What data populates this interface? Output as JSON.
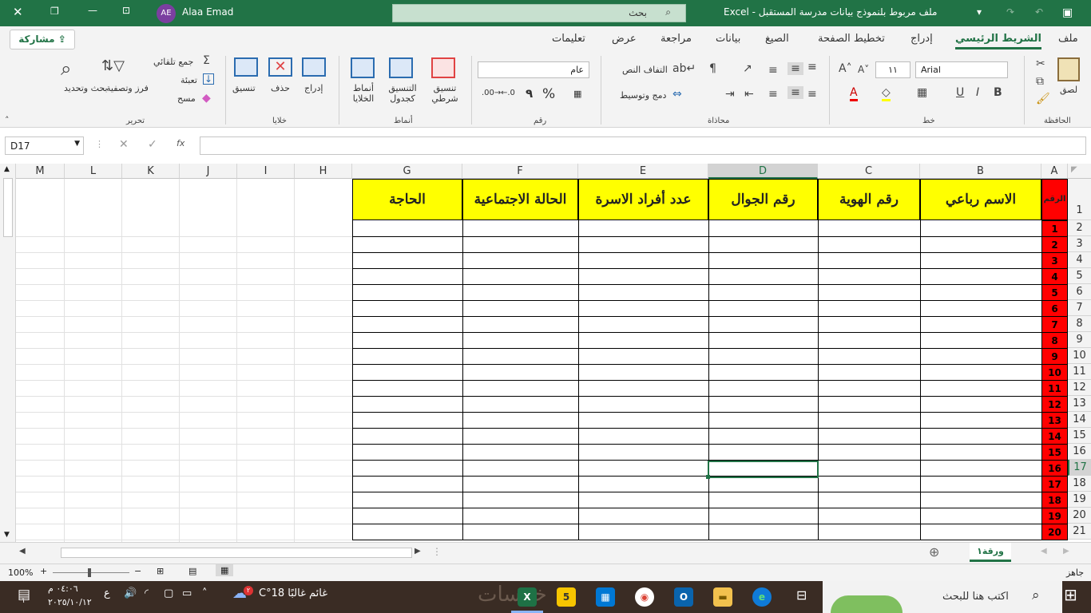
{
  "titlebar": {
    "doc_title": "ملف مربوط بلنموذج بيانات مدرسة المستقبل  -  Excel",
    "search_placeholder": "بحث",
    "user_name": "Alaa Emad",
    "user_initials": "AE"
  },
  "menu": {
    "tabs": [
      "ملف",
      "الشريط الرئيسي",
      "إدراج",
      "تخطيط الصفحة",
      "الصيغ",
      "بيانات",
      "مراجعة",
      "عرض",
      "تعليمات"
    ],
    "active": "الشريط الرئيسي",
    "share_label": "مشاركة"
  },
  "ribbon": {
    "clipboard": {
      "paste": "لصق",
      "group": "الحافظة"
    },
    "font": {
      "name": "Arial",
      "size": "١١",
      "bold": "B",
      "italic": "I",
      "underline": "U",
      "group": "خط"
    },
    "alignment": {
      "wrap": "التفاف النص",
      "merge": "دمج وتوسيط",
      "group": "محاذاة"
    },
    "number": {
      "format": "عام",
      "percent": "%",
      "comma": "٩",
      "group": "رقم"
    },
    "styles": {
      "conditional": "تنسيق شرطي",
      "table": "التنسيق كجدول",
      "cell": "أنماط الخلايا",
      "group": "أنماط"
    },
    "cells": {
      "insert": "إدراج",
      "delete": "حذف",
      "format": "تنسيق",
      "group": "خلايا"
    },
    "editing": {
      "autosum": "جمع تلقائي",
      "fill": "تعبئة",
      "clear": "مسح",
      "sort": "فرز وتصفية",
      "find": "بحث وتحديد",
      "group": "تحرير"
    }
  },
  "formula_bar": {
    "name_box": "D17",
    "fx": "fx",
    "value": ""
  },
  "sheet": {
    "columns": [
      "A",
      "B",
      "C",
      "D",
      "E",
      "F",
      "G",
      "H",
      "I",
      "J",
      "K",
      "L",
      "M"
    ],
    "selected_column": "D",
    "selected_row": "17",
    "rows": [
      "1",
      "2",
      "3",
      "4",
      "5",
      "6",
      "7",
      "8",
      "9",
      "10",
      "11",
      "12",
      "13",
      "14",
      "15",
      "16",
      "17",
      "18",
      "19",
      "20",
      "21"
    ],
    "header_num": "الرقم",
    "headers": [
      "الاسم رباعي",
      "رقم الهوية",
      "رقم الجوال",
      "عدد أفراد الاسرة",
      "الحالة الاجتماعية",
      "الحاجة"
    ],
    "numbers": [
      "1",
      "2",
      "3",
      "4",
      "5",
      "6",
      "7",
      "8",
      "9",
      "10",
      "11",
      "12",
      "13",
      "14",
      "15",
      "16",
      "17",
      "18",
      "19",
      "20"
    ],
    "sheet_tab": "ورقة١"
  },
  "statusbar": {
    "ready": "جاهز",
    "zoom": "100%"
  },
  "taskbar": {
    "search": "اكتب هنا للبحث",
    "weather": "غائم غالبًا  18°C",
    "weather_badge": "٢",
    "time": "٠٤:٠٦ م",
    "date": "٢٠٢٥/١٠/١٢",
    "lang": "ع",
    "notif_count": "١",
    "watermark": "خمسات"
  },
  "colors": {
    "excel_green": "#217346",
    "header_yellow": "#ffff00",
    "number_red": "#ff0000"
  }
}
